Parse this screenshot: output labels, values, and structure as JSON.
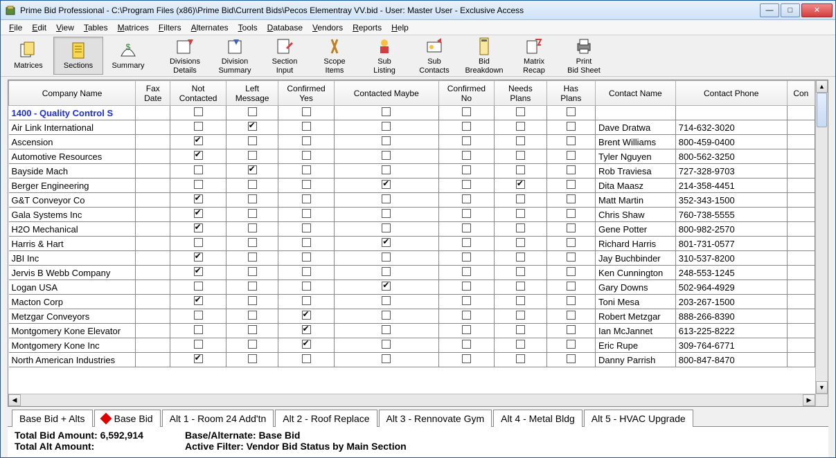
{
  "window": {
    "title": "Prime Bid Professional - C:\\Program Files (x86)\\Prime Bid\\Current Bids\\Pecos Elementray VV.bid - User: Master User - Exclusive Access"
  },
  "menu": [
    "File",
    "Edit",
    "View",
    "Tables",
    "Matrices",
    "Filters",
    "Alternates",
    "Tools",
    "Database",
    "Vendors",
    "Reports",
    "Help"
  ],
  "toolbar": [
    {
      "id": "matrices",
      "label": "Matrices"
    },
    {
      "id": "sections",
      "label": "Sections",
      "active": true
    },
    {
      "id": "summary",
      "label": "Summary"
    },
    {
      "id": "divdetails",
      "label": "Divisions Details"
    },
    {
      "id": "divsummary",
      "label": "Division Summary"
    },
    {
      "id": "secinput",
      "label": "Section Input"
    },
    {
      "id": "scopeitems",
      "label": "Scope Items"
    },
    {
      "id": "sublisting",
      "label": "Sub Listing"
    },
    {
      "id": "subcontacts",
      "label": "Sub Contacts"
    },
    {
      "id": "bidbreak",
      "label": "Bid Breakdown"
    },
    {
      "id": "matrixrecap",
      "label": "Matrix Recap"
    },
    {
      "id": "printbid",
      "label": "Print Bid Sheet"
    }
  ],
  "columns": [
    "Company Name",
    "Fax Date",
    "Not Contacted",
    "Left Message",
    "Confirmed Yes",
    "Contacted Maybe",
    "Confirmed No",
    "Needs Plans",
    "Has Plans",
    "Contact Name",
    "Contact Phone",
    "Con"
  ],
  "section_header": "1400 - Quality Control S",
  "rows": [
    {
      "company": "Air Link International",
      "nc": false,
      "lm": true,
      "cy": false,
      "cm": false,
      "cn": false,
      "np": false,
      "hp": false,
      "contact": "Dave Dratwa",
      "phone": "714-632-3020"
    },
    {
      "company": "Ascension",
      "nc": true,
      "lm": false,
      "cy": false,
      "cm": false,
      "cn": false,
      "np": false,
      "hp": false,
      "contact": "Brent Williams",
      "phone": "800-459-0400"
    },
    {
      "company": "Automotive Resources",
      "nc": true,
      "lm": false,
      "cy": false,
      "cm": false,
      "cn": false,
      "np": false,
      "hp": false,
      "contact": "Tyler Nguyen",
      "phone": "800-562-3250"
    },
    {
      "company": "Bayside Mach",
      "nc": false,
      "lm": true,
      "cy": false,
      "cm": false,
      "cn": false,
      "np": false,
      "hp": false,
      "contact": "Rob Traviesa",
      "phone": "727-328-9703"
    },
    {
      "company": "Berger Engineering",
      "nc": false,
      "lm": false,
      "cy": false,
      "cm": true,
      "cn": false,
      "np": true,
      "hp": false,
      "contact": "Dita Maasz",
      "phone": "214-358-4451"
    },
    {
      "company": "G&T Conveyor Co",
      "nc": true,
      "lm": false,
      "cy": false,
      "cm": false,
      "cn": false,
      "np": false,
      "hp": false,
      "contact": "Matt Martin",
      "phone": "352-343-1500"
    },
    {
      "company": "Gala Systems Inc",
      "nc": true,
      "lm": false,
      "cy": false,
      "cm": false,
      "cn": false,
      "np": false,
      "hp": false,
      "contact": "Chris Shaw",
      "phone": "760-738-5555"
    },
    {
      "company": "H2O Mechanical",
      "nc": true,
      "lm": false,
      "cy": false,
      "cm": false,
      "cn": false,
      "np": false,
      "hp": false,
      "contact": "Gene Potter",
      "phone": "800-982-2570"
    },
    {
      "company": "Harris & Hart",
      "nc": false,
      "lm": false,
      "cy": false,
      "cm": true,
      "cn": false,
      "np": false,
      "hp": false,
      "contact": "Richard Harris",
      "phone": "801-731-0577"
    },
    {
      "company": "JBI Inc",
      "nc": true,
      "lm": false,
      "cy": false,
      "cm": false,
      "cn": false,
      "np": false,
      "hp": false,
      "contact": "Jay Buchbinder",
      "phone": "310-537-8200"
    },
    {
      "company": "Jervis B Webb Company",
      "nc": true,
      "lm": false,
      "cy": false,
      "cm": false,
      "cn": false,
      "np": false,
      "hp": false,
      "contact": "Ken Cunnington",
      "phone": "248-553-1245"
    },
    {
      "company": "Logan USA",
      "nc": false,
      "lm": false,
      "cy": false,
      "cm": true,
      "cn": false,
      "np": false,
      "hp": false,
      "contact": "Gary Downs",
      "phone": "502-964-4929"
    },
    {
      "company": "Macton Corp",
      "nc": true,
      "lm": false,
      "cy": false,
      "cm": false,
      "cn": false,
      "np": false,
      "hp": false,
      "contact": "Toni Mesa",
      "phone": "203-267-1500"
    },
    {
      "company": "Metzgar Conveyors",
      "nc": false,
      "lm": false,
      "cy": true,
      "cm": false,
      "cn": false,
      "np": false,
      "hp": false,
      "contact": "Robert Metzgar",
      "phone": "888-266-8390"
    },
    {
      "company": "Montgomery Kone Elevator",
      "nc": false,
      "lm": false,
      "cy": true,
      "cm": false,
      "cn": false,
      "np": false,
      "hp": false,
      "contact": "Ian McJannet",
      "phone": "613-225-8222"
    },
    {
      "company": "Montgomery Kone Inc",
      "nc": false,
      "lm": false,
      "cy": true,
      "cm": false,
      "cn": false,
      "np": false,
      "hp": false,
      "contact": "Eric Rupe",
      "phone": "309-764-6771"
    },
    {
      "company": "North American Industries",
      "nc": true,
      "lm": false,
      "cy": false,
      "cm": false,
      "cn": false,
      "np": false,
      "hp": false,
      "contact": "Danny Parrish",
      "phone": "800-847-8470"
    }
  ],
  "tabs": [
    "Base Bid + Alts",
    "Base Bid",
    "Alt 1 - Room 24 Add'tn",
    "Alt 2 - Roof Replace",
    "Alt 3 - Rennovate Gym",
    "Alt 4 - Metal Bldg",
    "Alt 5 - HVAC Upgrade"
  ],
  "active_tab_index": 1,
  "status": {
    "total_bid_label": "Total Bid Amount:",
    "total_bid_value": "6,592,914",
    "total_alt_label": "Total Alt Amount:",
    "total_alt_value": "",
    "base_alt_label": "Base/Alternate:",
    "base_alt_value": "Base Bid",
    "filter_label": "Active Filter:",
    "filter_value": "Vendor Bid Status by Main Section"
  }
}
